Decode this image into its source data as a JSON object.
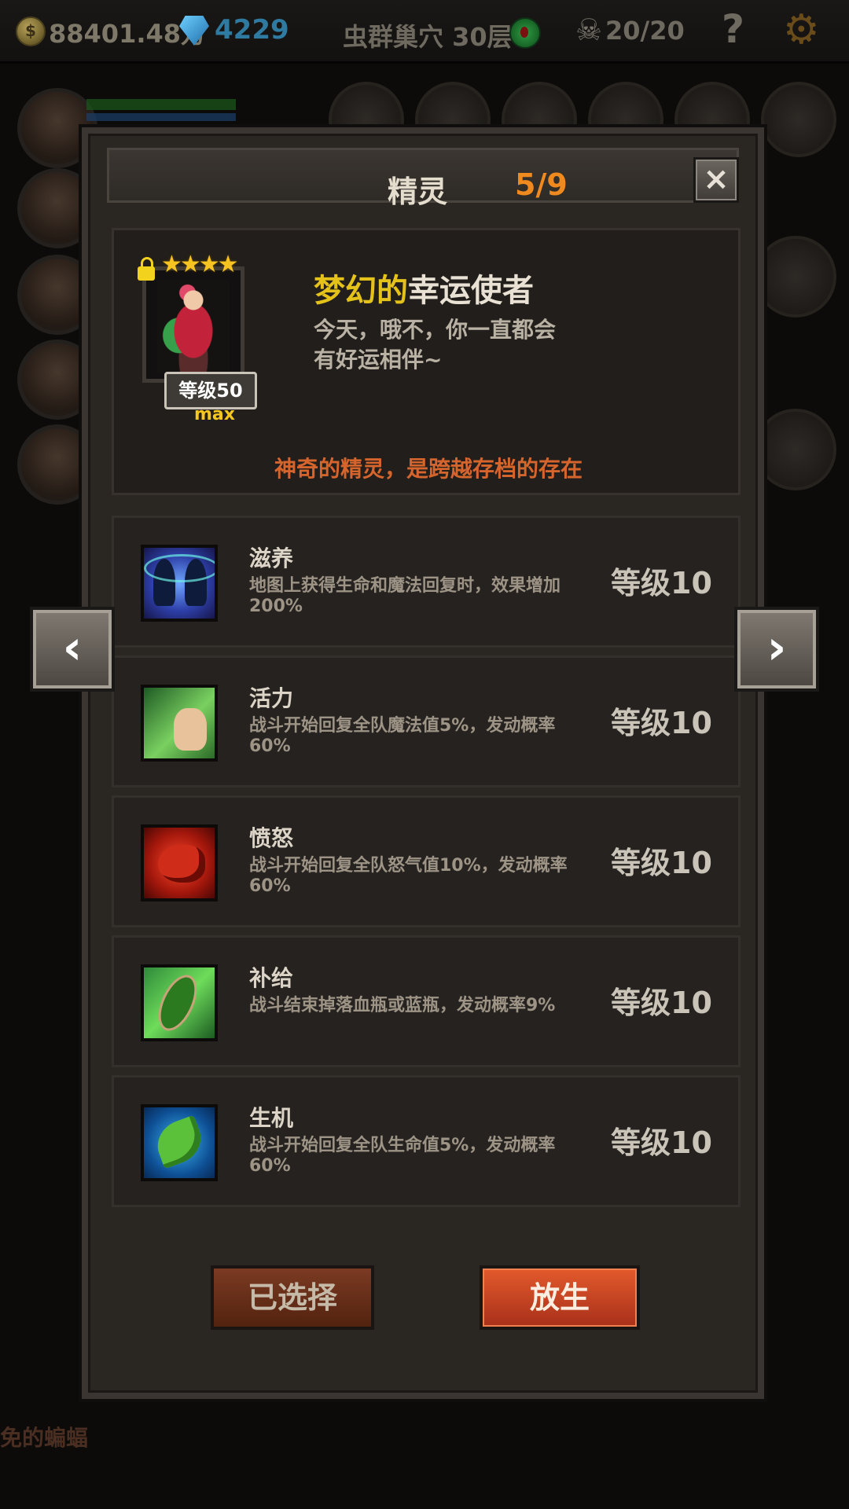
{
  "hud": {
    "gold": "88401.48万",
    "gems": "4229",
    "location": "虫群巢穴 30层",
    "kills": "20/20",
    "help_label": "?",
    "icons": [
      "coin-icon",
      "gem-icon",
      "green-orb-icon",
      "skull-icon",
      "help-icon",
      "gear-icon"
    ]
  },
  "background": {
    "partial_text": "免的蝙蝠"
  },
  "dialog": {
    "title": "精灵",
    "count": "5/9",
    "close_label": "×",
    "spirit": {
      "stars": "★★★★",
      "level_label": "等级50",
      "max_label": "max",
      "name_prefix": "梦幻的",
      "name_suffix": "幸运使者",
      "description_line1": "今天，哦不，你一直都会",
      "description_line2": "有好运相伴~",
      "note": "神奇的精灵，是跨越存档的存在"
    },
    "skills": [
      {
        "name": "滋养",
        "description": "地图上获得生命和魔法回复时，效果增加200%",
        "level": "等级10",
        "icon": "fairy-icon"
      },
      {
        "name": "活力",
        "description": "战斗开始回复全队魔法值5%，发动概率60%",
        "level": "等级10",
        "icon": "praying-icon"
      },
      {
        "name": "愤怒",
        "description": "战斗开始回复全队怒气值10%，发动概率60%",
        "level": "等级10",
        "icon": "beast-icon"
      },
      {
        "name": "补给",
        "description": "战斗结束掉落血瓶或蓝瓶，发动概率9%",
        "level": "等级10",
        "icon": "herb-hand-icon"
      },
      {
        "name": "生机",
        "description": "战斗开始回复全队生命值5%，发动概率60%",
        "level": "等级10",
        "icon": "leaf-icon"
      }
    ],
    "buttons": {
      "selected_label": "已选择",
      "release_label": "放生"
    },
    "nav": {
      "prev_label": "‹",
      "next_label": "›"
    }
  },
  "colors": {
    "title_count": "#f08a1f",
    "name_prefix": "#e4c21a",
    "note": "#d6652d",
    "release_button": "#c8401f"
  }
}
